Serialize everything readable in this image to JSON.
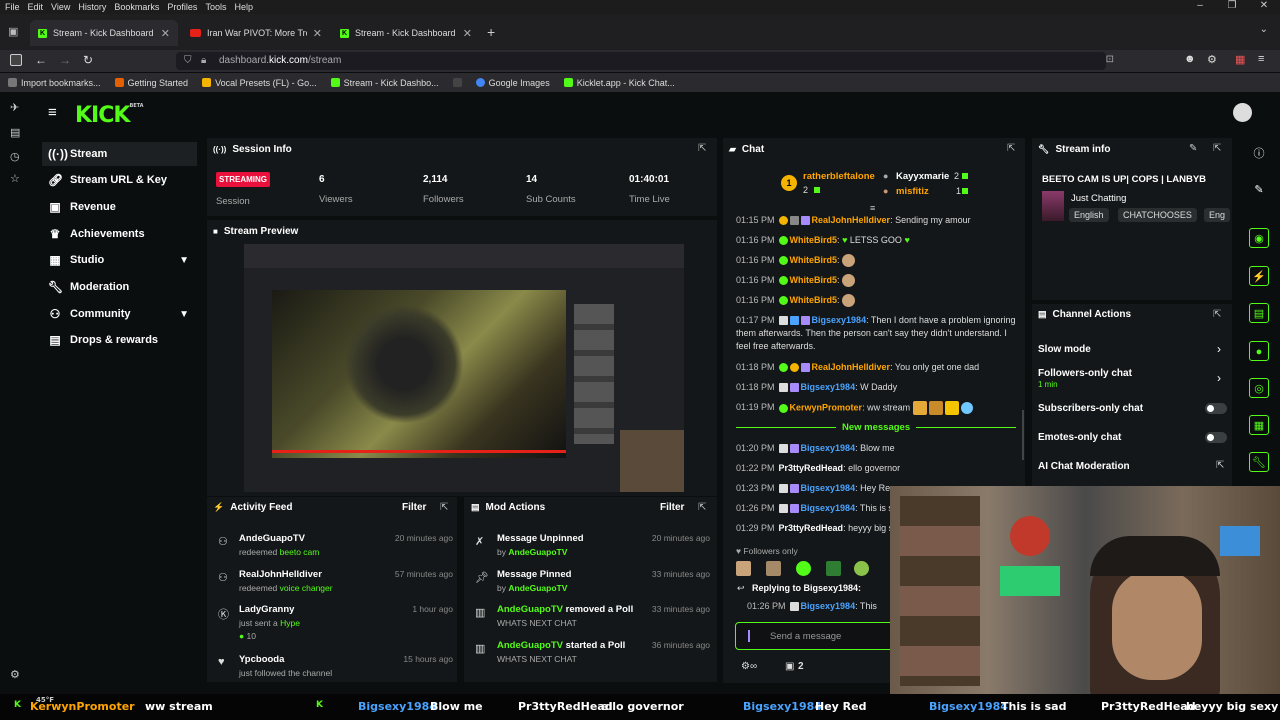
{
  "os_menu": [
    "File",
    "Edit",
    "View",
    "History",
    "Bookmarks",
    "Profiles",
    "Tools",
    "Help"
  ],
  "tabs": [
    {
      "label": "Stream - Kick Dashboard",
      "active": true
    },
    {
      "label": "Iran War PIVOT: More Troo..."
    },
    {
      "label": "Stream - Kick Dashboard"
    }
  ],
  "url": {
    "prefix": "dashboard.",
    "domain": "kick.com",
    "path": "/stream"
  },
  "bookmarks": [
    "Import bookmarks...",
    "Getting Started",
    "Vocal Presets (FL) - Go...",
    "Stream - Kick Dashbo...",
    "Google Images",
    "Kicklet.app - Kick Chat..."
  ],
  "logo": {
    "text": "KICK",
    "sup": "BETA"
  },
  "nav": [
    {
      "label": "Stream",
      "icon": "broadcast-icon"
    },
    {
      "label": "Stream URL & Key",
      "icon": "link-icon"
    },
    {
      "label": "Revenue",
      "icon": "dollar-icon"
    },
    {
      "label": "Achievements",
      "icon": "trophy-icon"
    },
    {
      "label": "Studio",
      "icon": "studio-icon"
    },
    {
      "label": "Moderation",
      "icon": "wrench-icon"
    },
    {
      "label": "Community",
      "icon": "people-icon"
    },
    {
      "label": "Drops & rewards",
      "icon": "gift-icon"
    }
  ],
  "session": {
    "title": "Session Info",
    "status": "STREAMING",
    "status_label": "Session",
    "stats": [
      {
        "value": "6",
        "label": "Viewers"
      },
      {
        "value": "2,114",
        "label": "Followers"
      },
      {
        "value": "14",
        "label": "Sub Counts"
      },
      {
        "value": "01:40:01",
        "label": "Time Live"
      }
    ]
  },
  "preview": {
    "title": "Stream Preview"
  },
  "activity": {
    "title": "Activity Feed",
    "filter": "Filter",
    "items": [
      {
        "name": "AndeGuapoTV",
        "action": "redeemed",
        "detail": "beeto cam",
        "time": "20 minutes ago"
      },
      {
        "name": "RealJohnHelldiver",
        "action": "redeemed",
        "detail": "voice changer",
        "time": "57 minutes ago"
      },
      {
        "name": "LadyGranny",
        "action": "just sent a",
        "detail": "Hype",
        "extra": "10",
        "time": "1 hour ago"
      },
      {
        "name": "Ypcbooda",
        "action": "just followed the channel",
        "detail": "",
        "time": "15 hours ago"
      }
    ]
  },
  "mod": {
    "title": "Mod Actions",
    "filter": "Filter",
    "items": [
      {
        "title": "Message Unpinned",
        "by": "by",
        "user": "AndeGuapoTV",
        "time": "20 minutes ago"
      },
      {
        "title": "Message Pinned",
        "by": "by",
        "user": "AndeGuapoTV",
        "time": "33 minutes ago"
      },
      {
        "user": "AndeGuapoTV",
        "title": "removed a Poll",
        "sub": "WHATS NEXT CHAT",
        "time": "33 minutes ago"
      },
      {
        "user": "AndeGuapoTV",
        "title": "started a Poll",
        "sub": "WHATS NEXT CHAT",
        "time": "36 minutes ago"
      }
    ]
  },
  "chat": {
    "title": "Chat",
    "leaders": [
      {
        "name": "ratherbleftalone",
        "count": "2"
      },
      {
        "name": "Kayyxmarie",
        "count": "2"
      },
      {
        "name": "misfitiz",
        "count": "1"
      }
    ],
    "messages": [
      {
        "time": "01:15 PM",
        "user": "RealJohnHelldiver",
        "color": "o",
        "text": "Sending my amour"
      },
      {
        "time": "01:16 PM",
        "user": "WhiteBird5",
        "color": "o",
        "text": "LETSS GOO"
      },
      {
        "time": "01:16 PM",
        "user": "WhiteBird5",
        "color": "o",
        "text": ""
      },
      {
        "time": "01:16 PM",
        "user": "WhiteBird5",
        "color": "o",
        "text": ""
      },
      {
        "time": "01:16 PM",
        "user": "WhiteBird5",
        "color": "o",
        "text": ""
      },
      {
        "time": "01:17 PM",
        "user": "Bigsexy1984",
        "color": "b",
        "text": "Then I dont have a problem ignoring them afterwards. Then the person can't say they didn't understand. I feel free afterwards."
      },
      {
        "time": "01:18 PM",
        "user": "RealJohnHelldiver",
        "color": "o",
        "text": "You only get one dad"
      },
      {
        "time": "01:18 PM",
        "user": "Bigsexy1984",
        "color": "b",
        "text": "W Daddy"
      },
      {
        "time": "01:19 PM",
        "user": "KerwynPromoter",
        "color": "o",
        "text": "ww stream"
      }
    ],
    "new_messages": "New messages",
    "new": [
      {
        "time": "01:20 PM",
        "user": "Bigsexy1984",
        "color": "b",
        "text": "Blow me"
      },
      {
        "time": "01:22 PM",
        "user": "Pr3ttyRedHead",
        "color": "w",
        "text": "ello governor"
      },
      {
        "time": "01:23 PM",
        "user": "Bigsexy1984",
        "color": "b",
        "text": "Hey Re"
      },
      {
        "time": "01:26 PM",
        "user": "Bigsexy1984",
        "color": "b",
        "text": "This is s"
      },
      {
        "time": "01:29 PM",
        "user": "Pr3ttyRedHead",
        "color": "w",
        "text": "heyyy big s"
      }
    ],
    "followers_only": "Followers only",
    "replying": "Replying to Bigsexy1984:",
    "reply_time": "01:26 PM",
    "reply_user": "Bigsexy1984",
    "reply_text": ": This",
    "placeholder": "Send a message",
    "count": "2"
  },
  "stream_info": {
    "title": "Stream info",
    "stream_title": "BEETO CAM IS UP| COPS | LANBYB",
    "category": "Just Chatting",
    "tags": [
      "English",
      "CHATCHOOSES",
      "Eng"
    ]
  },
  "channel_actions": {
    "title": "Channel Actions",
    "items": [
      {
        "label": "Slow mode"
      },
      {
        "label": "Followers-only chat",
        "sub": "1 min"
      },
      {
        "label": "Subscribers-only chat"
      },
      {
        "label": "Emotes-only chat"
      },
      {
        "label": "AI Chat Moderation"
      }
    ]
  },
  "ticker": {
    "temp": "45°F",
    "items": [
      {
        "user": "KerwynPromoter",
        "text": "ww stream"
      },
      {
        "user": "Bigsexy1984",
        "text": "Blow me"
      },
      {
        "user": "Pr3ttyRedHead",
        "text": "ello governor"
      },
      {
        "user": "Bigsexy1984",
        "text": "Hey Red"
      },
      {
        "user": "Bigsexy1984",
        "text": "This is sad"
      },
      {
        "user": "Pr3ttyRedHead",
        "text": "heyyy big sexy"
      }
    ]
  },
  "colors": {
    "kick_green": "#53fc18",
    "live_red": "#e9113c",
    "link_blue": "#4aa3ff"
  }
}
